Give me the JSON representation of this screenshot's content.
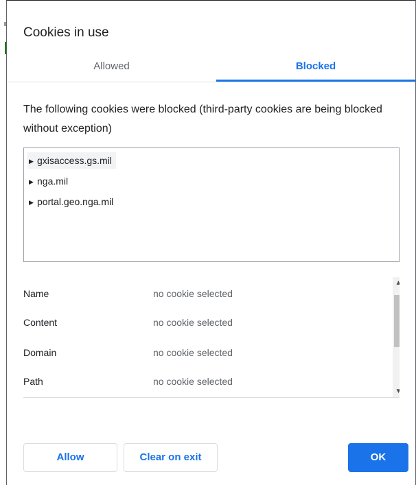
{
  "dialog": {
    "title": "Cookies in use"
  },
  "tabs": [
    {
      "label": "Allowed",
      "active": false
    },
    {
      "label": "Blocked",
      "active": true
    }
  ],
  "description": "The following cookies were blocked (third-party cookies are being blocked without exception)",
  "tree": {
    "items": [
      {
        "label": "gxisaccess.gs.mil",
        "selected": true
      },
      {
        "label": "nga.mil",
        "selected": false
      },
      {
        "label": "portal.geo.nga.mil",
        "selected": false
      }
    ]
  },
  "details": {
    "rows": [
      {
        "label": "Name",
        "value": "no cookie selected"
      },
      {
        "label": "Content",
        "value": "no cookie selected"
      },
      {
        "label": "Domain",
        "value": "no cookie selected"
      },
      {
        "label": "Path",
        "value": "no cookie selected"
      }
    ]
  },
  "buttons": {
    "allow": "Allow",
    "clear_on_exit": "Clear on exit",
    "ok": "OK"
  },
  "icons": {
    "expand": "triangle-right-icon",
    "scroll_up": "chevron-up-icon",
    "scroll_down": "chevron-down-icon"
  },
  "colors": {
    "accent": "#1a73e8",
    "text": "#202124",
    "muted": "#5f6368",
    "divider": "#dadce0"
  }
}
